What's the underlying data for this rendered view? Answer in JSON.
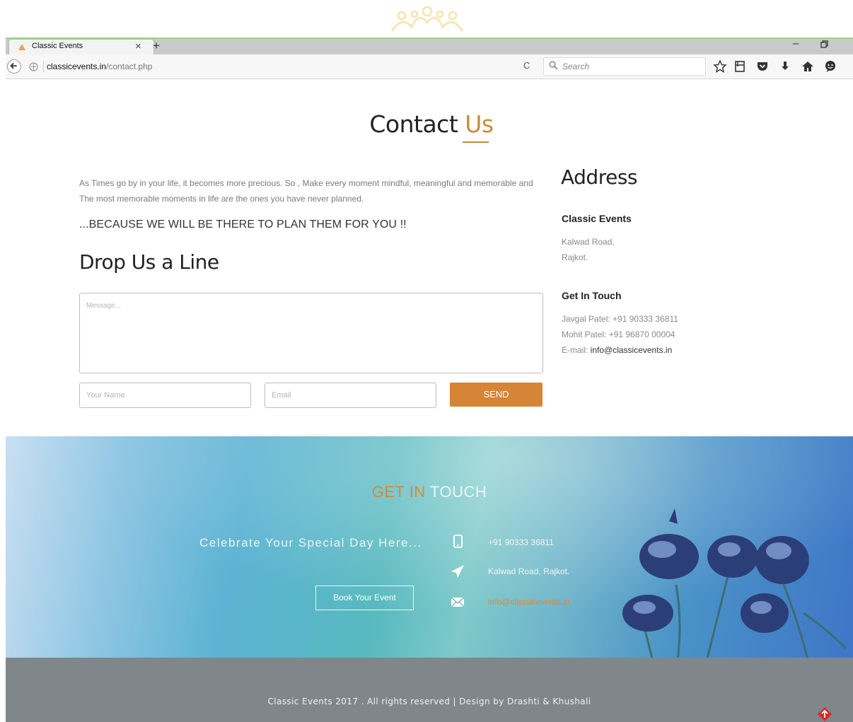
{
  "browser": {
    "tab_title": "Classic Events",
    "url_domain": "classicevents.in",
    "url_path": "/contact.php",
    "search_placeholder": "Search"
  },
  "page": {
    "heading_main": "Contact",
    "heading_accent": "Us",
    "intro_text": "As Times go by in your life, it becomes more precious. So , Make every moment mindful, meaningful and memorable and The most memorable moments in life are the ones you have never planned.",
    "tagline": "...BECAUSE WE WILL BE THERE TO PLAN THEM FOR YOU !!",
    "form_title": "Drop Us a Line",
    "message_placeholder": "Message...",
    "name_placeholder": "Your Name",
    "email_placeholder": "Email",
    "send_label": "SEND"
  },
  "address": {
    "title": "Address",
    "company": "Classic Events",
    "line1": "Kalwad Road,",
    "line2": "Rajkot.",
    "touch_title": "Get In Touch",
    "contact1": "Javgal Patel: +91 90333 36811",
    "contact2": "Mohit Patel: +91 96870 00004",
    "email_label": "E-mail: ",
    "email_value": "info@classicevents.in"
  },
  "footer": {
    "git_part1": "GET IN",
    "git_part2": " TOUCH",
    "celebrate": "Celebrate Your Special Day Here...",
    "book_button": "Book Your Event",
    "phone": "+91 90333 36811",
    "location": "Kalwad Road, Rajkot.",
    "email": "info@classicevents.in",
    "copyright": "Classic Events 2017 . All rights reserved | Design by Drashti & Khushali"
  },
  "colors": {
    "accent": "#d68436",
    "footer_bar": "#7f878a"
  }
}
